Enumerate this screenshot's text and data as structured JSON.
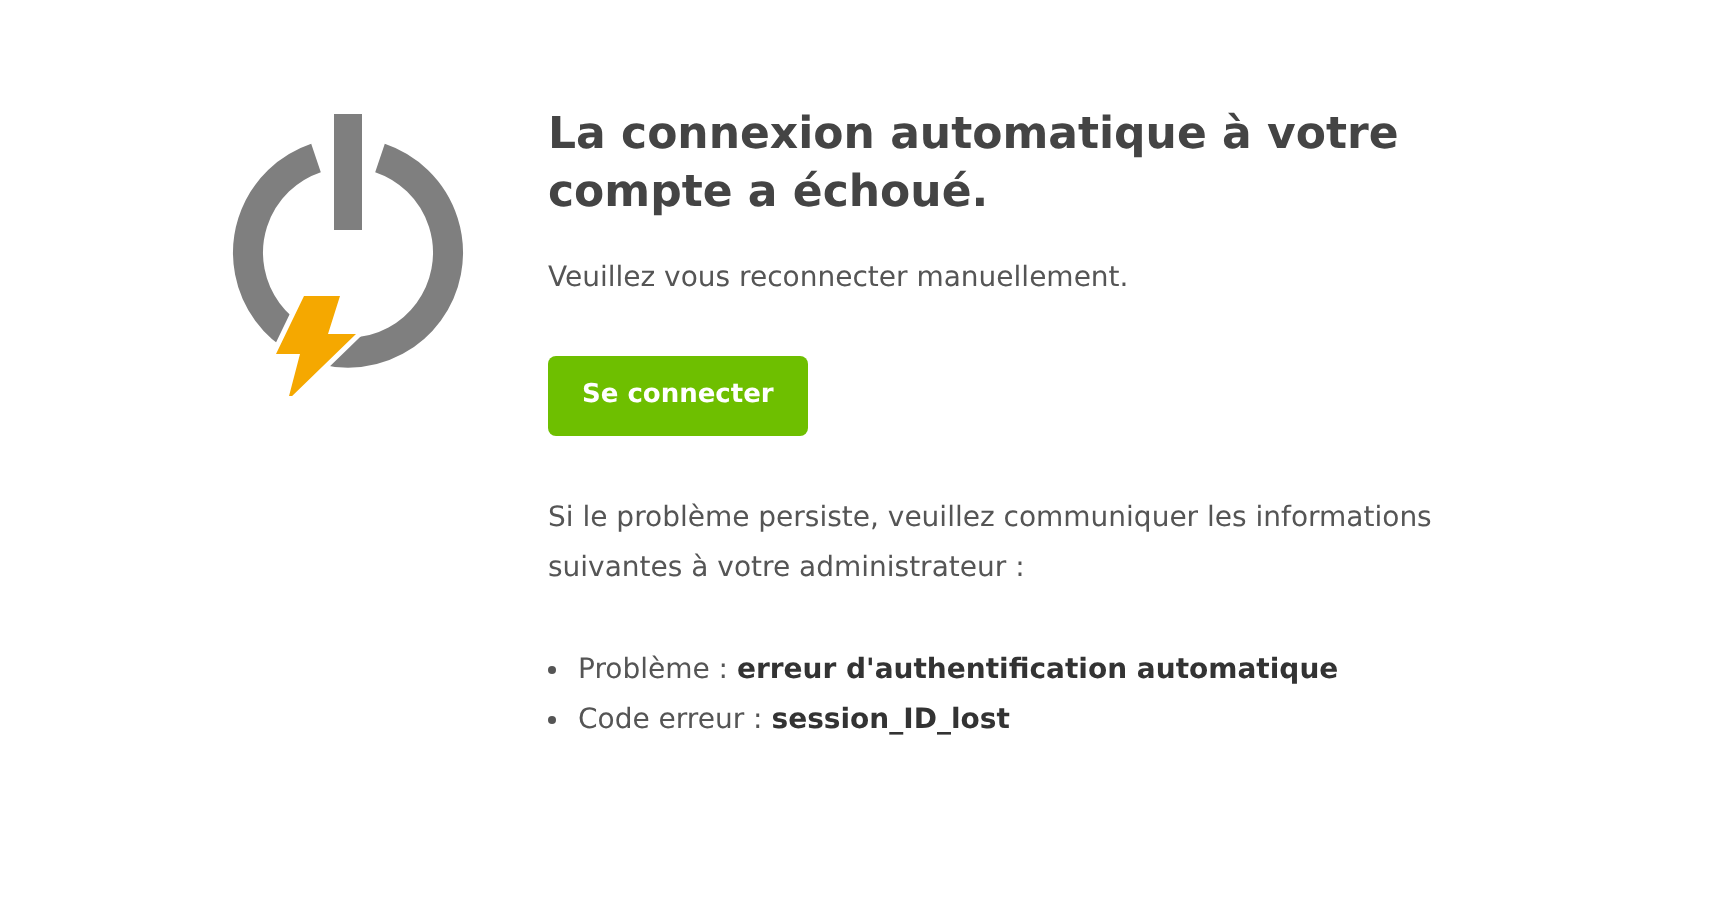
{
  "title": "La connexion automatique à votre compte a échoué.",
  "message": "Veuillez vous reconnecter manuellement.",
  "button": {
    "label": "Se connecter"
  },
  "help": "Si le problème persiste, veuillez communiquer les informations suivantes à votre administrateur :",
  "details": [
    {
      "text": "Problème : **erreur d'authentification automatique**"
    },
    {
      "text": "Code erreur : **session_ID_lost**"
    }
  ]
}
